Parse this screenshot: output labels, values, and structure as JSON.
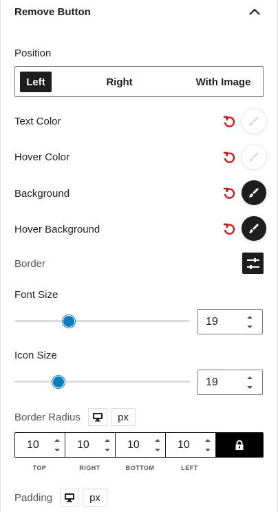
{
  "header": {
    "title": "Remove Button"
  },
  "position": {
    "label": "Position",
    "options": [
      "Left",
      "Right",
      "With Image"
    ],
    "selected": "Left"
  },
  "colors": [
    {
      "label": "Text Color",
      "swatch": "light",
      "swatch_hex": "#ffffff"
    },
    {
      "label": "Hover Color",
      "swatch": "light",
      "swatch_hex": "#ffffff"
    },
    {
      "label": "Background",
      "swatch": "dark",
      "swatch_hex": "#1e1e1e"
    },
    {
      "label": "Hover Background",
      "swatch": "dark",
      "swatch_hex": "#1e1e1e"
    }
  ],
  "reset_icon_color": "#cc1818",
  "border": {
    "label": "Border",
    "icon": "sliders-icon"
  },
  "font_size": {
    "label": "Font Size",
    "value": "19",
    "slider_fraction": 0.31
  },
  "icon_size": {
    "label": "Icon Size",
    "value": "19",
    "slider_fraction": 0.25
  },
  "accent_color": "#0a7dc2",
  "border_radius": {
    "label": "Border Radius",
    "unit": "px",
    "device_icon": "desktop-icon",
    "values": [
      "10",
      "10",
      "10",
      "10"
    ],
    "sides": [
      "TOP",
      "RIGHT",
      "BOTTOM",
      "LEFT"
    ],
    "lock_icon": "lock-icon"
  },
  "padding": {
    "label": "Padding",
    "unit": "px",
    "device_icon": "desktop-icon"
  }
}
